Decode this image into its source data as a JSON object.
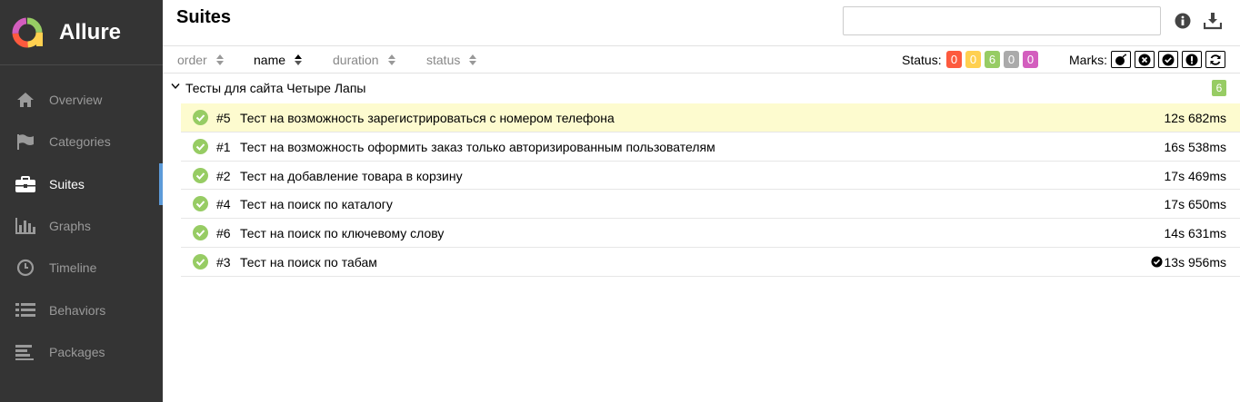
{
  "brand": {
    "name": "Allure"
  },
  "sidebar": {
    "items": [
      {
        "label": "Overview",
        "icon": "home-icon"
      },
      {
        "label": "Categories",
        "icon": "flag-icon"
      },
      {
        "label": "Suites",
        "icon": "briefcase-icon",
        "active": true
      },
      {
        "label": "Graphs",
        "icon": "bar-chart-icon"
      },
      {
        "label": "Timeline",
        "icon": "clock-icon"
      },
      {
        "label": "Behaviors",
        "icon": "list-icon"
      },
      {
        "label": "Packages",
        "icon": "align-left-icon"
      }
    ]
  },
  "header": {
    "title": "Suites",
    "search_value": ""
  },
  "sort": {
    "order": "order",
    "name": "name",
    "duration": "duration",
    "status": "status"
  },
  "status_filter": {
    "label": "Status:",
    "badges": [
      {
        "value": "0",
        "color": "#fd5a3e"
      },
      {
        "value": "0",
        "color": "#ffd050"
      },
      {
        "value": "6",
        "color": "#97cc64"
      },
      {
        "value": "0",
        "color": "#aaaaaa"
      },
      {
        "value": "0",
        "color": "#d35ebe"
      }
    ]
  },
  "marks": {
    "label": "Marks:",
    "icons": [
      "bomb-icon",
      "times-circle-icon",
      "check-circle-icon",
      "exclamation-circle-icon",
      "refresh-icon"
    ]
  },
  "group": {
    "title": "Тесты для сайта Четыре Лапы",
    "count": "6"
  },
  "tests": [
    {
      "num": "#5",
      "name": "Тест на возможность зарегистрироваться с номером телефона",
      "duration": "12s 682ms"
    },
    {
      "num": "#1",
      "name": "Тест на возможность оформить заказ только авторизированным пользователям",
      "duration": "16s 538ms"
    },
    {
      "num": "#2",
      "name": "Тест на добавление товара в корзину",
      "duration": "17s 469ms"
    },
    {
      "num": "#4",
      "name": "Тест на поиск по каталогу",
      "duration": "17s 650ms"
    },
    {
      "num": "#6",
      "name": "Тест на поиск по ключевому слову",
      "duration": "14s 631ms"
    },
    {
      "num": "#3",
      "name": "Тест на поиск по табам",
      "duration": "13s 956ms"
    }
  ]
}
